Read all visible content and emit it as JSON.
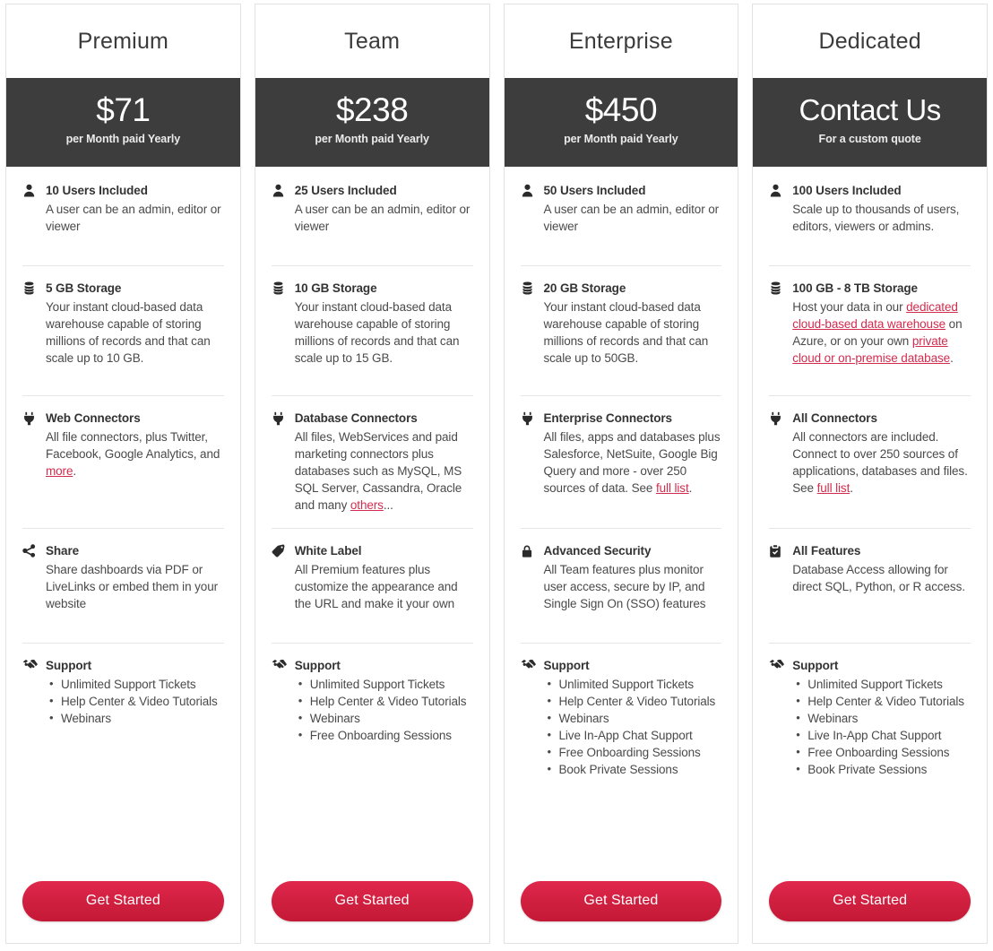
{
  "plans": [
    {
      "name": "Premium",
      "price": "$71",
      "period": "per Month paid Yearly",
      "users": {
        "title": "10 Users Included",
        "desc": "A user can be an admin, editor or viewer"
      },
      "storage": {
        "title": "5 GB Storage",
        "desc": "Your instant cloud-based data warehouse capable of storing millions of records and that can scale up to 10 GB."
      },
      "connectors": {
        "title": "Web Connectors",
        "desc_pre": "All file connectors, plus Twitter, Facebook, Google Analytics, and ",
        "link1": "more",
        "desc_post": "."
      },
      "extra": {
        "icon": "share-icon",
        "title": "Share",
        "desc": "Share dashboards via PDF or LiveLinks or embed them in your website"
      },
      "support": {
        "title": "Support",
        "items": [
          "Unlimited Support Tickets",
          "Help Center & Video Tutorials",
          "Webinars"
        ]
      },
      "cta": "Get Started"
    },
    {
      "name": "Team",
      "price": "$238",
      "period": "per Month paid Yearly",
      "users": {
        "title": "25 Users Included",
        "desc": "A user can be an admin, editor or viewer"
      },
      "storage": {
        "title": "10 GB Storage",
        "desc": "Your instant cloud-based data warehouse capable of storing millions of records and that can scale up to 15 GB."
      },
      "connectors": {
        "title": "Database Connectors",
        "desc_pre": "All files, WebServices and paid marketing connectors plus databases such as MySQL, MS SQL Server, Cassandra, Oracle and many ",
        "link1": "others",
        "desc_post": "..."
      },
      "extra": {
        "icon": "tag-icon",
        "title": "White Label",
        "desc": "All Premium features plus customize the appearance and the URL and make it your own"
      },
      "support": {
        "title": "Support",
        "items": [
          "Unlimited Support Tickets",
          "Help Center & Video Tutorials",
          "Webinars",
          "Free Onboarding Sessions"
        ]
      },
      "cta": "Get Started"
    },
    {
      "name": "Enterprise",
      "price": "$450",
      "period": "per Month paid Yearly",
      "users": {
        "title": "50 Users Included",
        "desc": "A user can be an admin, editor or viewer"
      },
      "storage": {
        "title": "20 GB Storage",
        "desc": "Your instant cloud-based data warehouse capable of storing millions of records and that can scale up to 50GB."
      },
      "connectors": {
        "title": "Enterprise Connectors",
        "desc_pre": "All files, apps and databases plus Salesforce, NetSuite, Google Big Query and more - over 250 sources of data. See ",
        "link1": "full list",
        "desc_post": "."
      },
      "extra": {
        "icon": "lock-icon",
        "title": "Advanced Security",
        "desc": "All Team features plus monitor user access, secure by IP, and Single Sign On (SSO) features"
      },
      "support": {
        "title": "Support",
        "items": [
          "Unlimited Support Tickets",
          "Help Center & Video Tutorials",
          "Webinars",
          "Live In-App Chat Support",
          "Free Onboarding Sessions",
          "Book Private Sessions"
        ]
      },
      "cta": "Get Started"
    },
    {
      "name": "Dedicated",
      "price": "Contact Us",
      "period": "For a custom quote",
      "users": {
        "title": "100 Users Included",
        "desc": "Scale up to thousands of users, editors, viewers or admins."
      },
      "storage": {
        "title": "100 GB - 8 TB Storage",
        "desc_pre": "Host your data in our ",
        "link1": "dedicated cloud-based data warehouse",
        "desc_mid": " on Azure, or on your own ",
        "link2": "private cloud or on-premise database",
        "desc_post": "."
      },
      "connectors": {
        "title": "All Connectors",
        "desc_pre": "All connectors are included. Connect to over 250 sources of applications, databases and files. See ",
        "link1": "full list",
        "desc_post": "."
      },
      "extra": {
        "icon": "clipboard-check-icon",
        "title": "All Features",
        "desc": "Database Access allowing for direct SQL, Python, or R access."
      },
      "support": {
        "title": "Support",
        "items": [
          "Unlimited Support Tickets",
          "Help Center & Video Tutorials",
          "Webinars",
          "Live In-App Chat Support",
          "Free Onboarding Sessions",
          "Book Private Sessions"
        ]
      },
      "cta": "Get Started"
    }
  ],
  "colors": {
    "price_band": "#3d3d3d",
    "link": "#d22c4e",
    "cta": "#cf1f3f",
    "card_border": "#e2e2e2"
  }
}
